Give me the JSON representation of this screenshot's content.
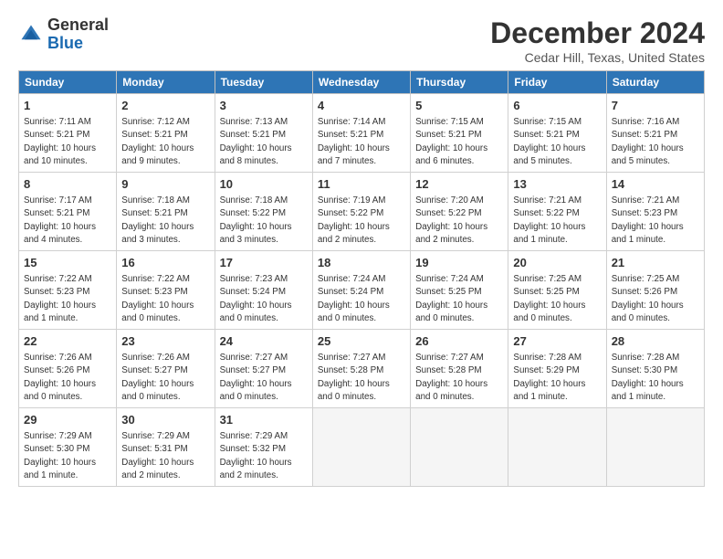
{
  "logo": {
    "general": "General",
    "blue": "Blue"
  },
  "title": "December 2024",
  "location": "Cedar Hill, Texas, United States",
  "days_of_week": [
    "Sunday",
    "Monday",
    "Tuesday",
    "Wednesday",
    "Thursday",
    "Friday",
    "Saturday"
  ],
  "weeks": [
    [
      {
        "day": "1",
        "info": "Sunrise: 7:11 AM\nSunset: 5:21 PM\nDaylight: 10 hours and 10 minutes."
      },
      {
        "day": "2",
        "info": "Sunrise: 7:12 AM\nSunset: 5:21 PM\nDaylight: 10 hours and 9 minutes."
      },
      {
        "day": "3",
        "info": "Sunrise: 7:13 AM\nSunset: 5:21 PM\nDaylight: 10 hours and 8 minutes."
      },
      {
        "day": "4",
        "info": "Sunrise: 7:14 AM\nSunset: 5:21 PM\nDaylight: 10 hours and 7 minutes."
      },
      {
        "day": "5",
        "info": "Sunrise: 7:15 AM\nSunset: 5:21 PM\nDaylight: 10 hours and 6 minutes."
      },
      {
        "day": "6",
        "info": "Sunrise: 7:15 AM\nSunset: 5:21 PM\nDaylight: 10 hours and 5 minutes."
      },
      {
        "day": "7",
        "info": "Sunrise: 7:16 AM\nSunset: 5:21 PM\nDaylight: 10 hours and 5 minutes."
      }
    ],
    [
      {
        "day": "8",
        "info": "Sunrise: 7:17 AM\nSunset: 5:21 PM\nDaylight: 10 hours and 4 minutes."
      },
      {
        "day": "9",
        "info": "Sunrise: 7:18 AM\nSunset: 5:21 PM\nDaylight: 10 hours and 3 minutes."
      },
      {
        "day": "10",
        "info": "Sunrise: 7:18 AM\nSunset: 5:22 PM\nDaylight: 10 hours and 3 minutes."
      },
      {
        "day": "11",
        "info": "Sunrise: 7:19 AM\nSunset: 5:22 PM\nDaylight: 10 hours and 2 minutes."
      },
      {
        "day": "12",
        "info": "Sunrise: 7:20 AM\nSunset: 5:22 PM\nDaylight: 10 hours and 2 minutes."
      },
      {
        "day": "13",
        "info": "Sunrise: 7:21 AM\nSunset: 5:22 PM\nDaylight: 10 hours and 1 minute."
      },
      {
        "day": "14",
        "info": "Sunrise: 7:21 AM\nSunset: 5:23 PM\nDaylight: 10 hours and 1 minute."
      }
    ],
    [
      {
        "day": "15",
        "info": "Sunrise: 7:22 AM\nSunset: 5:23 PM\nDaylight: 10 hours and 1 minute."
      },
      {
        "day": "16",
        "info": "Sunrise: 7:22 AM\nSunset: 5:23 PM\nDaylight: 10 hours and 0 minutes."
      },
      {
        "day": "17",
        "info": "Sunrise: 7:23 AM\nSunset: 5:24 PM\nDaylight: 10 hours and 0 minutes."
      },
      {
        "day": "18",
        "info": "Sunrise: 7:24 AM\nSunset: 5:24 PM\nDaylight: 10 hours and 0 minutes."
      },
      {
        "day": "19",
        "info": "Sunrise: 7:24 AM\nSunset: 5:25 PM\nDaylight: 10 hours and 0 minutes."
      },
      {
        "day": "20",
        "info": "Sunrise: 7:25 AM\nSunset: 5:25 PM\nDaylight: 10 hours and 0 minutes."
      },
      {
        "day": "21",
        "info": "Sunrise: 7:25 AM\nSunset: 5:26 PM\nDaylight: 10 hours and 0 minutes."
      }
    ],
    [
      {
        "day": "22",
        "info": "Sunrise: 7:26 AM\nSunset: 5:26 PM\nDaylight: 10 hours and 0 minutes."
      },
      {
        "day": "23",
        "info": "Sunrise: 7:26 AM\nSunset: 5:27 PM\nDaylight: 10 hours and 0 minutes."
      },
      {
        "day": "24",
        "info": "Sunrise: 7:27 AM\nSunset: 5:27 PM\nDaylight: 10 hours and 0 minutes."
      },
      {
        "day": "25",
        "info": "Sunrise: 7:27 AM\nSunset: 5:28 PM\nDaylight: 10 hours and 0 minutes."
      },
      {
        "day": "26",
        "info": "Sunrise: 7:27 AM\nSunset: 5:28 PM\nDaylight: 10 hours and 0 minutes."
      },
      {
        "day": "27",
        "info": "Sunrise: 7:28 AM\nSunset: 5:29 PM\nDaylight: 10 hours and 1 minute."
      },
      {
        "day": "28",
        "info": "Sunrise: 7:28 AM\nSunset: 5:30 PM\nDaylight: 10 hours and 1 minute."
      }
    ],
    [
      {
        "day": "29",
        "info": "Sunrise: 7:29 AM\nSunset: 5:30 PM\nDaylight: 10 hours and 1 minute."
      },
      {
        "day": "30",
        "info": "Sunrise: 7:29 AM\nSunset: 5:31 PM\nDaylight: 10 hours and 2 minutes."
      },
      {
        "day": "31",
        "info": "Sunrise: 7:29 AM\nSunset: 5:32 PM\nDaylight: 10 hours and 2 minutes."
      },
      {
        "day": "",
        "info": ""
      },
      {
        "day": "",
        "info": ""
      },
      {
        "day": "",
        "info": ""
      },
      {
        "day": "",
        "info": ""
      }
    ]
  ]
}
